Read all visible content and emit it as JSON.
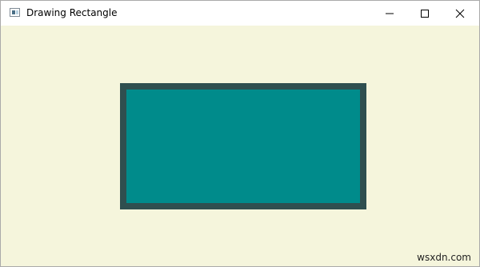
{
  "window": {
    "title": "Drawing Rectangle",
    "background": "#f5f5dc",
    "controls": {
      "minimize_icon": "minimize-icon",
      "maximize_icon": "maximize-icon",
      "close_icon": "close-icon"
    }
  },
  "rectangle": {
    "fill": "#008b8b",
    "stroke": "#2f4f4f"
  },
  "watermark": "wsxdn.com"
}
